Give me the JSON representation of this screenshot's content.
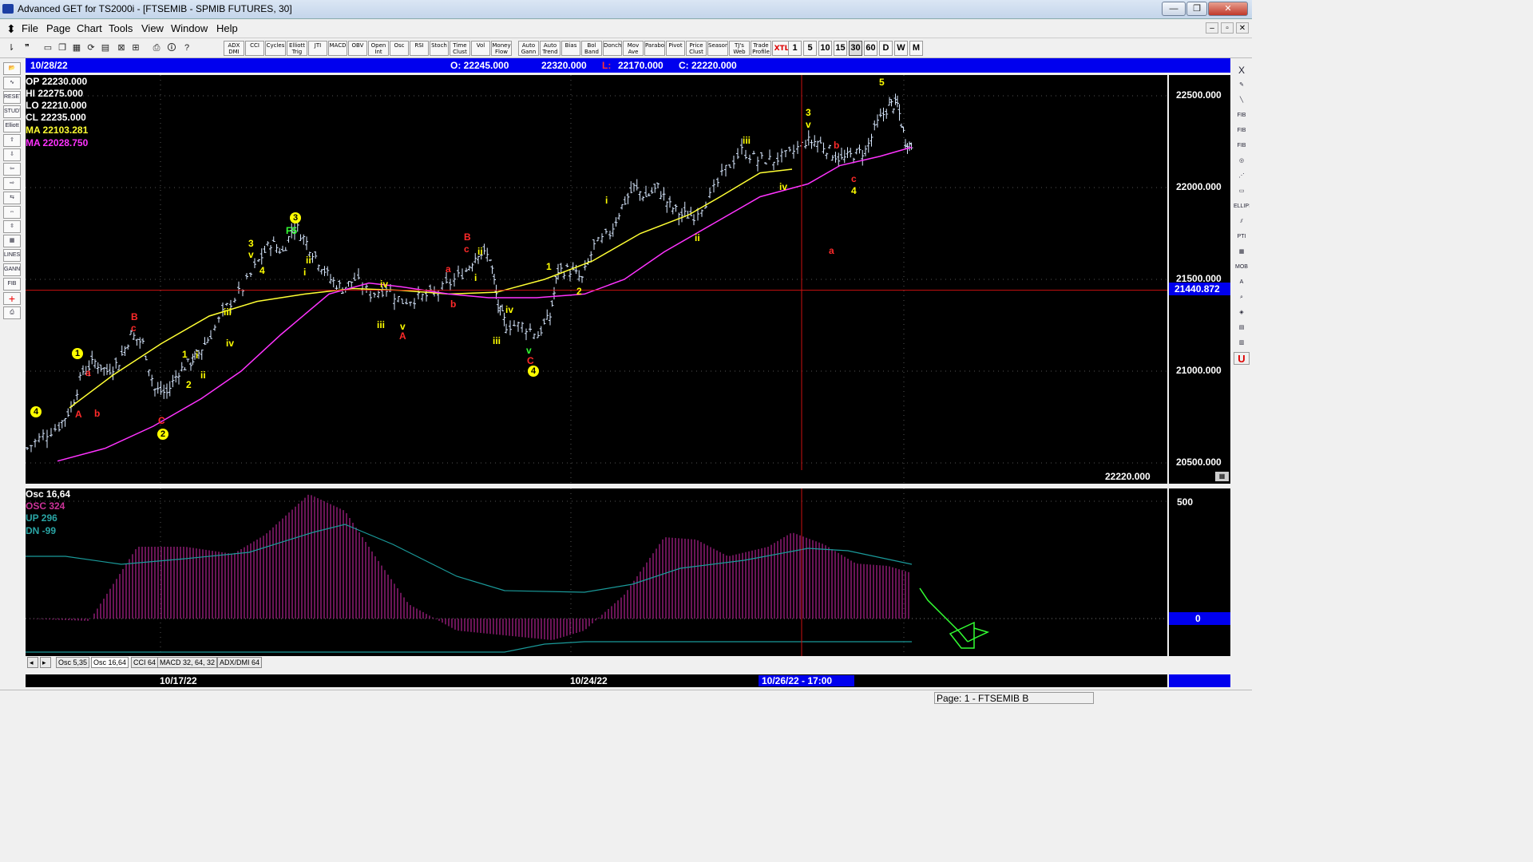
{
  "window": {
    "title": "Advanced GET for TS2000i - [FTSEMIB - SPMIB FUTURES, 30]",
    "minimize": "—",
    "maximize": "❐",
    "close": "✕"
  },
  "menu": [
    "File",
    "Page",
    "Chart",
    "Tools",
    "View",
    "Window",
    "Help"
  ],
  "mdi_controls": [
    "–",
    "▫",
    "✕"
  ],
  "toolbar": {
    "studies": [
      "ADX DMI",
      "CCI",
      "Cycles",
      "Elliott Trig",
      "JTI",
      "MACD",
      "OBV",
      "Open Int",
      "Osc",
      "RSI",
      "Stoch",
      "Time Clust",
      "Vol",
      "Money Flow",
      "Auto Gann",
      "Auto Trend",
      "Bias",
      "Bol Band",
      "Donch",
      "Mov Ave",
      "Parabolic",
      "Pivot",
      "Price Clust",
      "Seasonals",
      "TJ's Web",
      "Trade Profile",
      "XTL"
    ],
    "timeframes": [
      "1",
      "5",
      "10",
      "15",
      "30",
      "60",
      "D",
      "W",
      "M"
    ],
    "selected_timeframe": "30"
  },
  "left_tools": [
    "open",
    "wave",
    "RESET",
    "STUDY",
    "Elliott",
    "up",
    "down",
    "left",
    "right",
    "compress",
    "expand",
    "zoom",
    "grid",
    "LINES",
    "GANN",
    "FIB",
    "cross",
    "print"
  ],
  "right_tools": [
    "X",
    "pen",
    "line",
    "FIB RET",
    "FIB EXT",
    "FIB TIME",
    "circle",
    "fan",
    "box",
    "ELLIPS",
    "channel",
    "PTI",
    "grid",
    "MOB",
    "A",
    "zoom",
    "fill",
    "grid2",
    "book",
    "U"
  ],
  "header": {
    "date": "10/28/22",
    "open": "O: 22245.000",
    "high": "22320.000",
    "low_label": "L:",
    "low": "22170.000",
    "close": "C: 22220.000"
  },
  "overlay": {
    "op": "OP  22230.000",
    "hi": "HI   22275.000",
    "lo": "LO  22210.000",
    "cl": "CL  22235.000",
    "ma1": "MA  22103.281",
    "ma2": "MA  22028.750",
    "ma1_color": "#ffff33",
    "ma2_color": "#ff33ff"
  },
  "price_axis": {
    "ticks": [
      "22500.000",
      "22000.000",
      "21500.000",
      "21000.000",
      "20500.000"
    ],
    "cursor_value": "21440.872",
    "last_price": "22220.000"
  },
  "osc": {
    "title": "Osc 16,64",
    "osc": "OSC 324",
    "up": "UP   296",
    "dn": "DN   -99",
    "axis_ticks": [
      "500",
      "0"
    ]
  },
  "tabs": [
    "Osc 5,35",
    "Osc 16,64",
    "CCI 64",
    "MACD 32, 64, 32",
    "ADX/DMI 64"
  ],
  "selected_tab": "Osc 16,64",
  "dates": [
    "10/17/22",
    "10/24/22",
    "10/26/22 - 17:00"
  ],
  "status": "Page: 1 - FTSEMIB B",
  "wave_labels": [
    {
      "t": "4",
      "c": "#ffff00",
      "circle": true
    },
    {
      "t": "1",
      "c": "#ffff00",
      "circle": true
    },
    {
      "t": "a",
      "c": "#ff2a2a"
    },
    {
      "t": "A",
      "c": "#ff2a2a"
    },
    {
      "t": "b",
      "c": "#ff2a2a"
    },
    {
      "t": "B",
      "c": "#ff2a2a"
    },
    {
      "t": "c",
      "c": "#ff2a2a"
    },
    {
      "t": "C",
      "c": "#ff2a2a"
    },
    {
      "t": "2",
      "c": "#ffff00",
      "circle": true
    },
    {
      "t": "1",
      "c": "#ffff00"
    },
    {
      "t": "i",
      "c": "#ffff00"
    },
    {
      "t": "2",
      "c": "#ffff00"
    },
    {
      "t": "ii",
      "c": "#ffff00"
    },
    {
      "t": "iii",
      "c": "#ffff00"
    },
    {
      "t": "iv",
      "c": "#ffff00"
    },
    {
      "t": "3",
      "c": "#ffff00"
    },
    {
      "t": "v",
      "c": "#ffff00"
    },
    {
      "t": "4",
      "c": "#ffff00"
    },
    {
      "t": "3",
      "c": "#ffff00",
      "circle": true
    },
    {
      "t": "F5",
      "c": "#33ff33"
    },
    {
      "t": "ii",
      "c": "#ffff00"
    },
    {
      "t": "i",
      "c": "#ffff00"
    },
    {
      "t": "iv",
      "c": "#ffff00"
    },
    {
      "t": "iii",
      "c": "#ffff00"
    },
    {
      "t": "v",
      "c": "#ffff00"
    },
    {
      "t": "A",
      "c": "#ff2a2a"
    },
    {
      "t": "a",
      "c": "#ff2a2a"
    },
    {
      "t": "b",
      "c": "#ff2a2a"
    },
    {
      "t": "B",
      "c": "#ff2a2a"
    },
    {
      "t": "c",
      "c": "#ff2a2a"
    },
    {
      "t": "ii",
      "c": "#ffff00"
    },
    {
      "t": "i",
      "c": "#ffff00"
    },
    {
      "t": "iv",
      "c": "#ffff00"
    },
    {
      "t": "iii",
      "c": "#ffff00"
    },
    {
      "t": "v",
      "c": "#33ff33"
    },
    {
      "t": "C",
      "c": "#ff2a2a"
    },
    {
      "t": "4",
      "c": "#ffff00",
      "circle": true
    },
    {
      "t": "1",
      "c": "#ffff00"
    },
    {
      "t": "2",
      "c": "#ffff00"
    },
    {
      "t": "i",
      "c": "#ffff00"
    },
    {
      "t": "ii",
      "c": "#ffff00"
    },
    {
      "t": "iii",
      "c": "#ffff00"
    },
    {
      "t": "iv",
      "c": "#ffff00"
    },
    {
      "t": "3",
      "c": "#ffff00"
    },
    {
      "t": "v",
      "c": "#ffff00"
    },
    {
      "t": "a",
      "c": "#ff2a2a"
    },
    {
      "t": "b",
      "c": "#ff2a2a"
    },
    {
      "t": "c",
      "c": "#ff2a2a"
    },
    {
      "t": "4",
      "c": "#ffff00"
    },
    {
      "t": "5",
      "c": "#ffff00"
    }
  ]
}
